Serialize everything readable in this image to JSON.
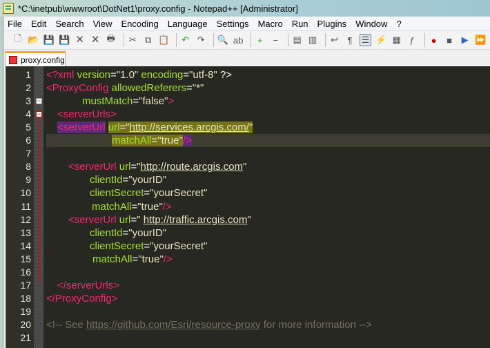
{
  "window": {
    "title": "*C:\\inetpub\\wwwroot\\DotNet1\\proxy.config - Notepad++ [Administrator]"
  },
  "menu": [
    "File",
    "Edit",
    "Search",
    "View",
    "Encoding",
    "Language",
    "Settings",
    "Macro",
    "Run",
    "Plugins",
    "Window",
    "?"
  ],
  "toolbar": [
    "new-icon",
    "open-icon",
    "save-icon",
    "save-all-icon",
    "close-icon",
    "close-all-icon",
    "print-icon",
    "|",
    "cut-icon",
    "copy-icon",
    "paste-icon",
    "|",
    "undo-icon",
    "redo-icon",
    "|",
    "find-icon",
    "replace-icon",
    "|",
    "zoom-in-icon",
    "zoom-out-icon",
    "|",
    "sync-vertical-icon",
    "sync-horizontal-icon",
    "|",
    "word-wrap-icon",
    "show-all-chars-icon",
    "indent-guide-icon",
    "udl-icon",
    "doc-map-icon",
    "function-list-icon",
    "|",
    "record-macro-icon",
    "stop-record-icon",
    "play-macro-icon",
    "run-macro-multiple-icon"
  ],
  "tab": {
    "label": "proxy.config"
  },
  "colors": {
    "background": "#272822",
    "tag": "#f92672",
    "attribute": "#a6e22e",
    "comment": "#75715e",
    "current_line": "#3e3d32"
  },
  "lines": [
    {
      "n": "1",
      "indent": 0,
      "tokens": [
        [
          "tag",
          "<?"
        ],
        [
          "tag",
          "xml"
        ],
        [
          "attr",
          " version"
        ],
        [
          "eq",
          "="
        ],
        [
          "str",
          "\"1.0\""
        ],
        [
          "attr",
          " encoding"
        ],
        [
          "eq",
          "="
        ],
        [
          "str",
          "\"utf-8\""
        ],
        [
          "eq",
          " ?>"
        ]
      ]
    },
    {
      "n": "2",
      "indent": 0,
      "tokens": [
        [
          "tag",
          "<ProxyConfig"
        ],
        [
          "attr",
          " allowedReferers"
        ],
        [
          "eq",
          "="
        ],
        [
          "str",
          "\"*\""
        ]
      ]
    },
    {
      "n": "3",
      "indent": 52,
      "tokens": [
        [
          "attr",
          "mustMatch"
        ],
        [
          "eq",
          "="
        ],
        [
          "str",
          "\"false\""
        ],
        [
          "tag",
          ">"
        ]
      ]
    },
    {
      "n": "4",
      "indent": 16,
      "tokens": [
        [
          "tag",
          "<serverUrls>"
        ]
      ]
    },
    {
      "n": "5",
      "indent": 16,
      "tokens": [
        [
          "tag hl-tag",
          "<serverUrl"
        ],
        [
          "eq",
          " "
        ],
        [
          "attr hl-attr",
          "url"
        ],
        [
          "eq hl-attr",
          "="
        ],
        [
          "str hl-attr",
          "\""
        ],
        [
          "url hl-attr",
          "http://services.arcgis.com/"
        ],
        [
          "str hl-attr",
          "\""
        ]
      ]
    },
    {
      "n": "6",
      "indent": 95,
      "current": true,
      "tokens": [
        [
          "attr hl-attr",
          "matchAll"
        ],
        [
          "eq hl-attr",
          "="
        ],
        [
          "str hl-attr",
          "\"true\""
        ],
        [
          "tag hl-tag",
          "/>"
        ]
      ]
    },
    {
      "n": "7",
      "indent": 0,
      "tokens": []
    },
    {
      "n": "8",
      "indent": 32,
      "tokens": [
        [
          "tag",
          "<serverUrl"
        ],
        [
          "attr",
          " url"
        ],
        [
          "eq",
          "="
        ],
        [
          "str",
          "\""
        ],
        [
          "url",
          "http://route.arcgis.com"
        ],
        [
          "str",
          "\""
        ]
      ]
    },
    {
      "n": "9",
      "indent": 63,
      "tokens": [
        [
          "attr",
          "clientId"
        ],
        [
          "eq",
          "="
        ],
        [
          "str",
          "\"yourID\""
        ]
      ]
    },
    {
      "n": "10",
      "indent": 63,
      "tokens": [
        [
          "attr",
          "clientSecret"
        ],
        [
          "eq",
          "="
        ],
        [
          "str",
          "\"yourSecret\""
        ]
      ]
    },
    {
      "n": "11",
      "indent": 66,
      "tokens": [
        [
          "attr",
          "matchAll"
        ],
        [
          "eq",
          "="
        ],
        [
          "str",
          "\"true\""
        ],
        [
          "tag",
          "/>"
        ]
      ]
    },
    {
      "n": "12",
      "indent": 32,
      "tokens": [
        [
          "tag",
          "<serverUrl"
        ],
        [
          "attr",
          " url"
        ],
        [
          "eq",
          "="
        ],
        [
          "str",
          "\" "
        ],
        [
          "url",
          "http://traffic.arcgis.com"
        ],
        [
          "str",
          "\""
        ]
      ]
    },
    {
      "n": "13",
      "indent": 63,
      "tokens": [
        [
          "attr",
          "clientId"
        ],
        [
          "eq",
          "="
        ],
        [
          "str",
          "\"yourID\""
        ]
      ]
    },
    {
      "n": "14",
      "indent": 63,
      "tokens": [
        [
          "attr",
          "clientSecret"
        ],
        [
          "eq",
          "="
        ],
        [
          "str",
          "\"yourSecret\""
        ]
      ]
    },
    {
      "n": "15",
      "indent": 67,
      "tokens": [
        [
          "attr",
          "matchAll"
        ],
        [
          "eq",
          "="
        ],
        [
          "str",
          "\"true\""
        ],
        [
          "tag",
          "/>"
        ]
      ]
    },
    {
      "n": "16",
      "indent": 0,
      "tokens": []
    },
    {
      "n": "17",
      "indent": 16,
      "tokens": [
        [
          "tag",
          "</serverUrls>"
        ]
      ]
    },
    {
      "n": "18",
      "indent": 0,
      "tokens": [
        [
          "tag",
          "</ProxyConfig>"
        ]
      ]
    },
    {
      "n": "19",
      "indent": 0,
      "tokens": []
    },
    {
      "n": "20",
      "indent": 0,
      "tokens": [
        [
          "com",
          "<!-- See "
        ],
        [
          "comurl",
          "https://github.com/Esri/resource-proxy"
        ],
        [
          "com",
          " for more information -->"
        ]
      ]
    },
    {
      "n": "21",
      "indent": 0,
      "tokens": []
    }
  ]
}
